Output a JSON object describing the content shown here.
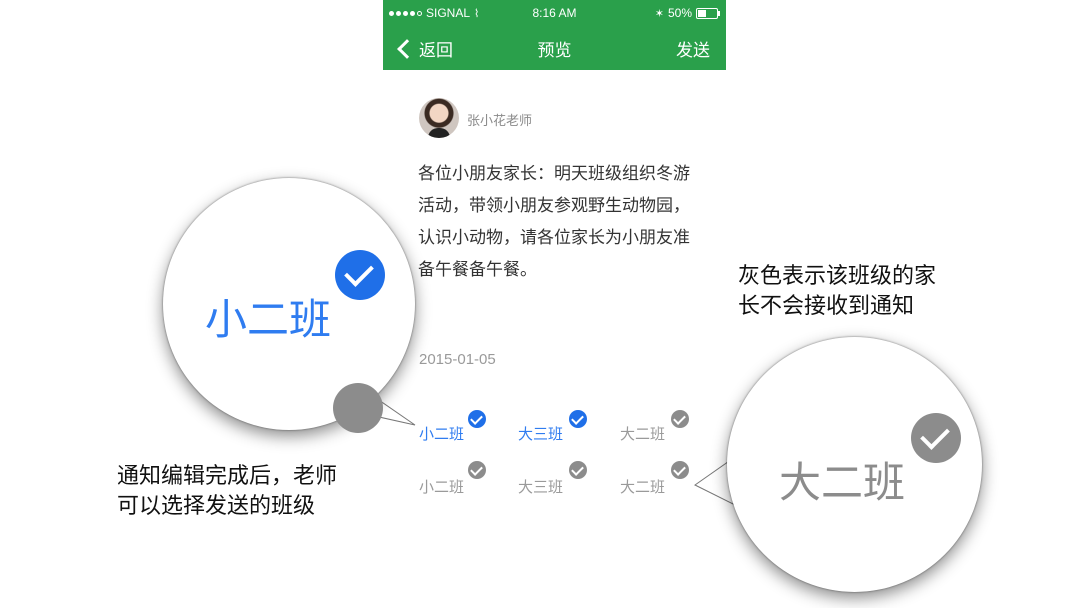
{
  "status_bar": {
    "carrier": "SIGNAL",
    "time": "8:16 AM",
    "battery": "50%",
    "battery_level": 0.5
  },
  "nav": {
    "back_label": "返回",
    "title": "预览",
    "send_label": "发送"
  },
  "post": {
    "sender": "张小花老师",
    "message": "各位小朋友家长：明天班级组织冬游活动，带领小朋友参观野生动物园，认识小动物，请各位家长为小朋友准备午餐备午餐。",
    "date": "2015-01-05"
  },
  "classes": [
    {
      "label": "小二班",
      "selected": true
    },
    {
      "label": "大三班",
      "selected": true
    },
    {
      "label": "大二班",
      "selected": false
    },
    {
      "label": "小二班",
      "selected": false
    },
    {
      "label": "大三班",
      "selected": false
    },
    {
      "label": "大二班",
      "selected": false
    }
  ],
  "zoom_left": {
    "label": "小二班",
    "selected": true
  },
  "zoom_right": {
    "label": "大二班",
    "selected": false
  },
  "captions": {
    "left_line1": "通知编辑完成后，老师",
    "left_line2": "可以选择发送的班级",
    "right_line1": "灰色表示该班级的家",
    "right_line2": "长不会接收到通知"
  },
  "colors": {
    "brand_green": "#2aa04b",
    "selected_blue": "#1f6fe8",
    "unselected_gray": "#8c8c8c"
  }
}
